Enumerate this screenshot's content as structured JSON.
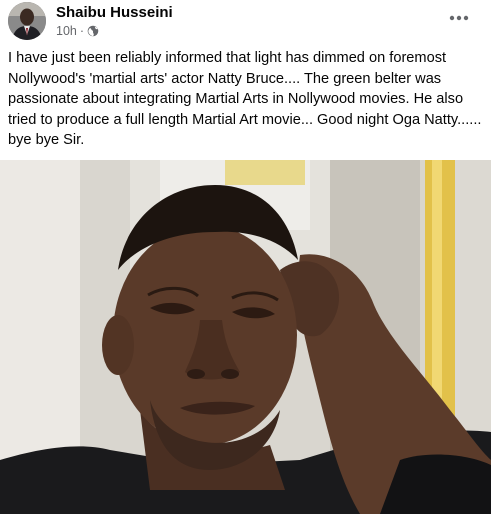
{
  "post": {
    "author": {
      "name": "Shaibu Husseini",
      "avatar_icon": "avatar-photo"
    },
    "meta": {
      "time": "10h",
      "separator": "·",
      "audience_icon": "globe-icon"
    },
    "more_icon": "more-horizontal-icon",
    "text": "I have just been reliably informed that light has dimmed on foremost Nollywood's 'martial arts' actor Natty Bruce.... The green belter was passionate about integrating Martial Arts in Nollywood movies. He also tried to produce a full length Martial Art movie... Good night Oga Natty...... bye bye Sir.",
    "photo": {
      "icon": "post-photo"
    }
  },
  "colors": {
    "name": "#050505",
    "meta": "#65676b",
    "background": "#ffffff"
  }
}
